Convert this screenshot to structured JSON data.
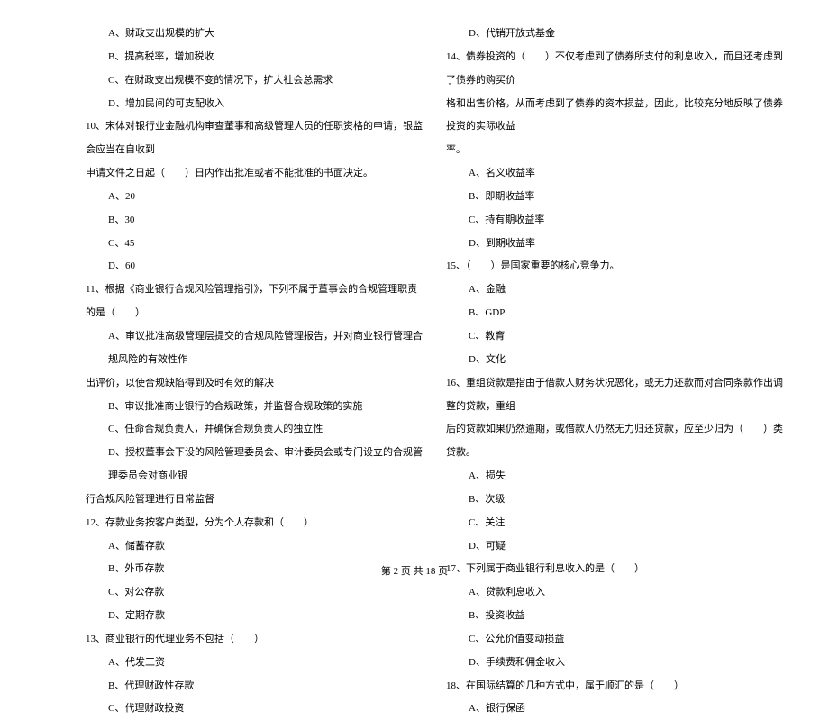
{
  "left": {
    "q09_optA": "A、财政支出规模的扩大",
    "q09_optB": "B、提高税率，增加税收",
    "q09_optC": "C、在财政支出规模不变的情况下，扩大社会总需求",
    "q09_optD": "D、增加民间的可支配收入",
    "q10_line1": "10、宋体对银行业金融机构审查董事和高级管理人员的任职资格的申请，银监会应当在自收到",
    "q10_line2": "申请文件之日起（　　）日内作出批准或者不能批准的书面决定。",
    "q10_optA": "A、20",
    "q10_optB": "B、30",
    "q10_optC": "C、45",
    "q10_optD": "D、60",
    "q11_line1": "11、根据《商业银行合规风险管理指引》，下列不属于董事会的合规管理职责的是（　　）",
    "q11_optA_l1": "A、审议批准高级管理层提交的合规风险管理报告，并对商业银行管理合规风险的有效性作",
    "q11_optA_l2": "出评价，以使合规缺陷得到及时有效的解决",
    "q11_optB": "B、审议批准商业银行的合规政策，并监督合规政策的实施",
    "q11_optC": "C、任命合规负责人，并确保合规负责人的独立性",
    "q11_optD_l1": "D、授权董事会下设的风险管理委员会、审计委员会或专门设立的合规管理委员会对商业银",
    "q11_optD_l2": "行合规风险管理进行日常监督",
    "q12_line1": "12、存款业务按客户类型，分为个人存款和（　　）",
    "q12_optA": "A、储蓄存款",
    "q12_optB": "B、外币存款",
    "q12_optC": "C、对公存款",
    "q12_optD": "D、定期存款",
    "q13_line1": "13、商业银行的代理业务不包括（　　）",
    "q13_optA": "A、代发工资",
    "q13_optB": "B、代理财政性存款",
    "q13_optC": "C、代理财政投资"
  },
  "right": {
    "q13_optD": "D、代销开放式基金",
    "q14_line1": "14、债券投资的（　　）不仅考虑到了债券所支付的利息收入，而且还考虑到了债券的购买价",
    "q14_line2": "格和出售价格，从而考虑到了债券的资本损益，因此，比较充分地反映了债券投资的实际收益",
    "q14_line3": "率。",
    "q14_optA": "A、名义收益率",
    "q14_optB": "B、即期收益率",
    "q14_optC": "C、持有期收益率",
    "q14_optD": "D、到期收益率",
    "q15_line1": "15、（　　）是国家重要的核心竞争力。",
    "q15_optA": "A、金融",
    "q15_optB": "B、GDP",
    "q15_optC": "C、教育",
    "q15_optD": "D、文化",
    "q16_line1": "16、重组贷款是指由于借款人财务状况恶化，或无力还款而对合同条款作出调整的贷款，重组",
    "q16_line2": "后的贷款如果仍然逾期，或借款人仍然无力归还贷款，应至少归为（　　）类贷款。",
    "q16_optA": "A、损失",
    "q16_optB": "B、次级",
    "q16_optC": "C、关注",
    "q16_optD": "D、可疑",
    "q17_line1": "17、下列属于商业银行利息收入的是（　　）",
    "q17_optA": "A、贷款利息收入",
    "q17_optB": "B、投资收益",
    "q17_optC": "C、公允价值变动损益",
    "q17_optD": "D、手续费和佣金收入",
    "q18_line1": "18、在国际结算的几种方式中，属于顺汇的是（　　）",
    "q18_optA": "A、银行保函"
  },
  "footer": "第 2 页 共 18 页"
}
